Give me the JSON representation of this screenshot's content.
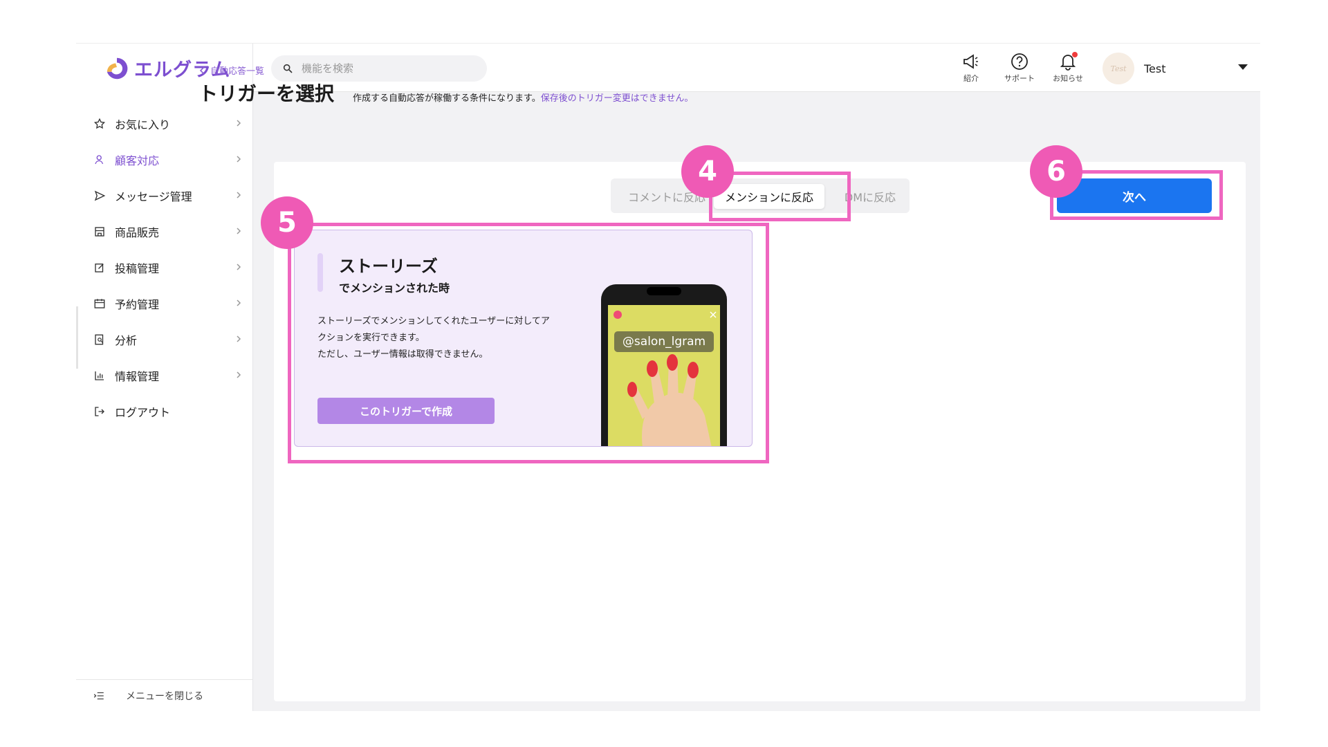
{
  "brand": {
    "name": "エルグラム",
    "color": "#7d4fd0"
  },
  "search": {
    "placeholder": "機能を検索"
  },
  "top_icons": [
    {
      "icon": "megaphone-icon",
      "label": "紹介"
    },
    {
      "icon": "help-circle-icon",
      "label": "サポート"
    },
    {
      "icon": "bell-icon",
      "label": "お知らせ"
    }
  ],
  "user": {
    "avatar_text": "Test",
    "name": "Test"
  },
  "sidebar": {
    "items": [
      {
        "label": "お気に入り",
        "icon": "star-icon"
      },
      {
        "label": "顧客対応",
        "icon": "person-icon"
      },
      {
        "label": "メッセージ管理",
        "icon": "send-icon"
      },
      {
        "label": "商品販売",
        "icon": "store-icon"
      },
      {
        "label": "投稿管理",
        "icon": "edit-icon"
      },
      {
        "label": "予約管理",
        "icon": "calendar-icon"
      },
      {
        "label": "分析",
        "icon": "report-icon"
      },
      {
        "label": "情報管理",
        "icon": "bar-chart-icon"
      },
      {
        "label": "ログアウト",
        "icon": "logout-icon"
      }
    ],
    "footer_label": "メニューを閉じる"
  },
  "breadcrumb": {
    "back_label": "自動応答一覧"
  },
  "page": {
    "title": "トリガーを選択",
    "description": "作成する自動応答が稼働する条件になります。",
    "warning": "保存後のトリガー変更はできません。"
  },
  "tabs": [
    {
      "label": "コメントに反応",
      "selected": false
    },
    {
      "label": "メンションに反応",
      "selected": true
    },
    {
      "label": "DMに反応",
      "selected": false
    }
  ],
  "next_button": {
    "label": "次へ",
    "color": "#1b75f0"
  },
  "card": {
    "title": "ストーリーズ",
    "subtitle": "でメンションされた時",
    "desc_line1": "ストーリーズでメンションしてくれたユーザーに対してア",
    "desc_line2": "クションを実行できます。",
    "desc_line3": "ただし、ユーザー情報は取得できません。",
    "button_label": "このトリガーで作成",
    "phone_tag": "@salon_lgram"
  },
  "annotations": [
    {
      "number": "4"
    },
    {
      "number": "5"
    },
    {
      "number": "6"
    }
  ],
  "highlight_color": "#ef66c0"
}
